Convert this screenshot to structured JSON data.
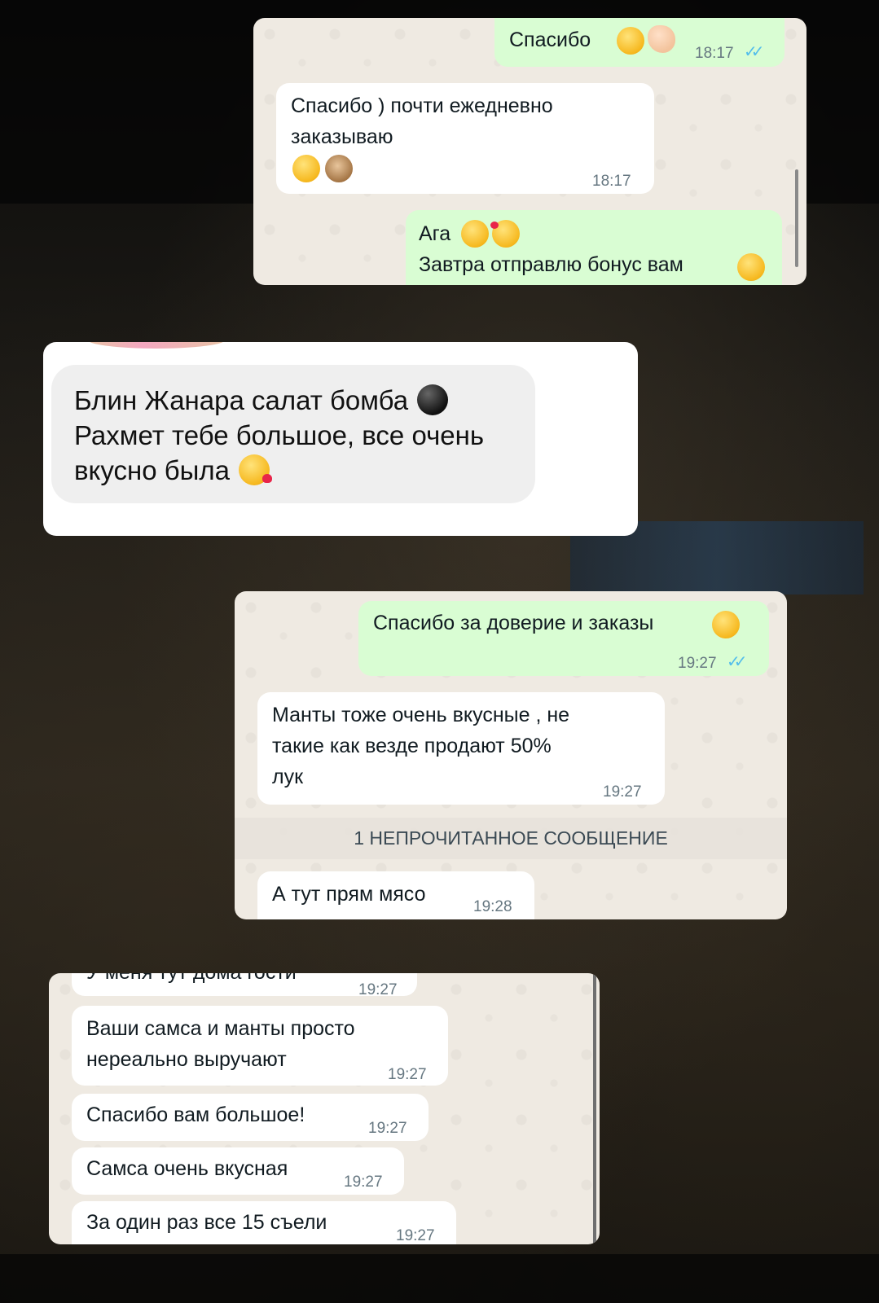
{
  "card1": {
    "messages": [
      {
        "dir": "out",
        "text": "Спасибо ",
        "time": "18:17",
        "ticks": "✓✓"
      },
      {
        "dir": "in",
        "lines": [
          "Спасибо ) почти ежедневно",
          "заказываю"
        ],
        "time": "18:17"
      },
      {
        "dir": "out",
        "lines": [
          "Ага",
          "Завтра отправлю бонус вам"
        ]
      }
    ]
  },
  "ig": {
    "lines": [
      "Блин Жанара салат бомба ",
      "Рахмет тебе большое, все очень",
      "вкусно была "
    ]
  },
  "card2": {
    "messages": [
      {
        "dir": "out",
        "text": "Спасибо за доверие и заказы",
        "time": "19:27",
        "ticks": "✓✓"
      },
      {
        "dir": "in",
        "lines": [
          "Манты тоже очень вкусные , не",
          "такие как везде продают 50%",
          "лук"
        ],
        "time": "19:27"
      },
      {
        "dir": "in",
        "text": "А тут прям мясо",
        "time": "19:28"
      }
    ],
    "unread_label": "1 НЕПРОЧИТАННОЕ СООБЩЕНИЕ"
  },
  "card3": {
    "messages": [
      {
        "dir": "in",
        "text": "У меня тут дома гости",
        "time": "19:27"
      },
      {
        "dir": "in",
        "lines": [
          "Ваши самса и манты просто",
          "нереально выручают"
        ],
        "time": "19:27"
      },
      {
        "dir": "in",
        "text": "Спасибо вам большое!",
        "time": "19:27"
      },
      {
        "dir": "in",
        "text": "Самса очень вкусная",
        "time": "19:27"
      },
      {
        "dir": "in",
        "text": "За один раз все 15 съели",
        "time": "19:27"
      }
    ]
  },
  "colors": {
    "chat_bg": "#efeae2",
    "incoming": "#ffffff",
    "outgoing": "#d9fdd3",
    "tick_read": "#53bdeb",
    "timestamp": "#667781"
  },
  "icons": [
    "smiling-blush-emoji",
    "ok-hand-emoji",
    "rofl-emoji",
    "see-no-evil-monkey-emoji",
    "grinning-emoji",
    "smiling-hearts-emoji",
    "bomb-emoji",
    "kissing-heart-emoji",
    "double-check-icon"
  ]
}
